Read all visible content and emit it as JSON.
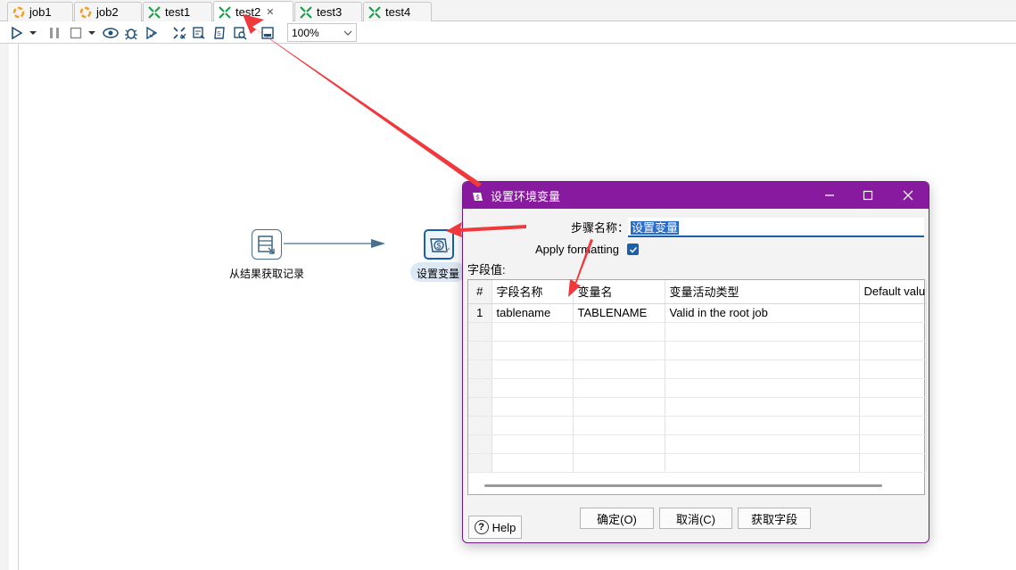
{
  "tabs": [
    {
      "label": "job1",
      "type": "job"
    },
    {
      "label": "job2",
      "type": "job"
    },
    {
      "label": "test1",
      "type": "transformation"
    },
    {
      "label": "test2",
      "type": "transformation",
      "active": true
    },
    {
      "label": "test3",
      "type": "transformation"
    },
    {
      "label": "test4",
      "type": "transformation"
    }
  ],
  "toolbar": {
    "zoom_value": "100%",
    "icons": [
      "run-icon",
      "dropdown-icon",
      "pause-icon",
      "stop-icon",
      "dropdown-icon",
      "preview-icon",
      "debug-icon",
      "replay-icon",
      "verify-icon",
      "impact-icon",
      "sql-icon",
      "explore-db-icon",
      "show-results-icon"
    ]
  },
  "canvas": {
    "step1_label": "从结果获取记录",
    "step2_label": "设置变量"
  },
  "dialog": {
    "title": "设置环境变量",
    "step_name_label": "步骤名称：",
    "step_name_value": "设置变量",
    "apply_formatting_label": "Apply formatting",
    "apply_formatting_checked": true,
    "fields_label": "字段值:",
    "columns": [
      "#",
      "字段名称",
      "变量名",
      "变量活动类型",
      "Default valu"
    ],
    "rows": [
      {
        "num": "1",
        "field_name": "tablename",
        "variable_name": "TABLENAME",
        "variable_type": "Valid in the root job",
        "default_value": ""
      }
    ],
    "ok_label": "确定(O)",
    "cancel_label": "取消(C)",
    "get_fields_label": "获取字段",
    "help_label": "Help"
  },
  "colors": {
    "dialog_title_bg": "#881aa0",
    "annotation_arrow": "#f0393c",
    "accent_blue": "#1a5fa8"
  }
}
